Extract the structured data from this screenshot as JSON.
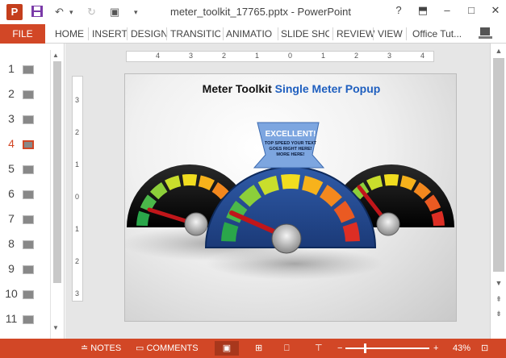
{
  "window": {
    "title": "meter_toolkit_17765.pptx - PowerPoint",
    "help": "?",
    "min": "–",
    "max": "□",
    "close": "✕"
  },
  "quick_access": {
    "logo": "P"
  },
  "ribbon": {
    "file": "FILE",
    "tabs": [
      "HOME",
      "INSERT",
      "DESIGN",
      "TRANSITIO",
      "ANIMATIO",
      "SLIDE SHO",
      "REVIEW",
      "VIEW"
    ],
    "account": "Office Tut..."
  },
  "thumbnails": [
    "1",
    "2",
    "3",
    "4",
    "5",
    "6",
    "7",
    "8",
    "9",
    "10",
    "11"
  ],
  "active_slide": 4,
  "ruler": {
    "h": [
      "4",
      "3",
      "2",
      "1",
      "0",
      "1",
      "2",
      "3",
      "4"
    ],
    "v": [
      "3",
      "2",
      "1",
      "0",
      "1",
      "2",
      "3"
    ]
  },
  "slide": {
    "title_a": "Meter Toolkit",
    "title_b": "Single Meter Popup",
    "callout_title": "EXCELLENT!",
    "callout_l1": "TOP SPEED YOUR TEXT",
    "callout_l2": "GOES RIGHT HERE!",
    "callout_l3": "MORE HERE!"
  },
  "status": {
    "notes": "NOTES",
    "comments": "COMMENTS",
    "zoom": "43%"
  },
  "colors": {
    "accent": "#d24726",
    "title_blue": "#1f5fbf"
  }
}
